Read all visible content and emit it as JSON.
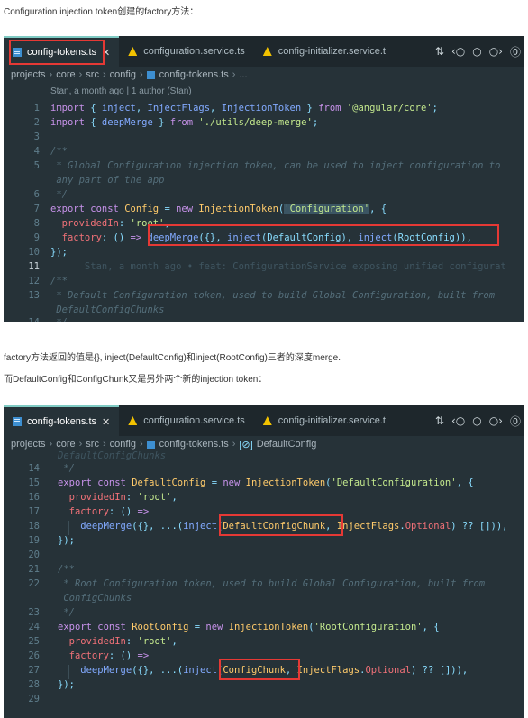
{
  "intro_text": "Configuration injection token创建的factory方法：",
  "middle_text_1": "factory方法返回的值是{}, inject(DefaultConfig)和inject(RootConfig)三者的深度merge.",
  "middle_text_2": "而DefaultConfig和ConfigChunk又是另外两个新的injection token：",
  "screen1": {
    "tabs": [
      {
        "label": "config-tokens.ts",
        "close": "✕"
      },
      {
        "label": "configuration.service.ts"
      },
      {
        "label": "config-initializer.service.t"
      }
    ],
    "actions": [
      "⇅",
      "‹○",
      "○",
      "○›",
      "⓪"
    ],
    "breadcrumb": [
      "projects",
      "core",
      "src",
      "config",
      "config-tokens.ts",
      "..."
    ],
    "blame_header": "Stan, a month ago | 1 author (Stan)",
    "lines": [
      "1",
      "2",
      "3",
      "4",
      "5",
      "",
      "6",
      "7",
      "8",
      "9",
      "10",
      "11",
      "12",
      "13",
      "",
      "14"
    ],
    "code": {
      "l1_a": "import",
      "l1_b": " { ",
      "l1_c": "inject",
      "l1_d": ", ",
      "l1_e": "InjectFlags",
      "l1_f": ", ",
      "l1_g": "InjectionToken",
      "l1_h": " } ",
      "l1_i": "from",
      "l1_j": " '@angular/core'",
      "l1_k": ";",
      "l2_a": "import",
      "l2_b": " { ",
      "l2_c": "deepMerge",
      "l2_d": " } ",
      "l2_e": "from",
      "l2_f": " './utils/deep-merge'",
      "l2_g": ";",
      "l4": "/**",
      "l5a": " * Global Configuration injection token, can be used to inject configuration to",
      "l5b": " any part of the app",
      "l6": " */",
      "l7_a": "export",
      "l7_b": " const ",
      "l7_c": "Config",
      "l7_d": " = ",
      "l7_e": "new ",
      "l7_f": "InjectionToken",
      "l7_g": "(",
      "l7_h": "'Configuration'",
      "l7_i": ", {",
      "l8_a": "  providedIn",
      "l8_b": ": ",
      "l8_c": "'root'",
      "l8_d": ",",
      "l9_a": "  factory",
      "l9_b": ": () ",
      "l9_c": "=>",
      "l9_d": " deepMerge",
      "l9_e": "({}, ",
      "l9_f": "inject",
      "l9_g": "(DefaultConfig), ",
      "l9_h": "inject",
      "l9_i": "(RootConfig)),",
      "l10": "});",
      "l11_blame": "      Stan, a month ago • feat: ConfigurationService exposing unified configurat",
      "l12": "/**",
      "l13a": " * Default Configuration token, used to build Global Configuration, built from",
      "l13b": " DefaultConfigChunks",
      "l14": " */"
    }
  },
  "screen2": {
    "tabs": [
      {
        "label": "config-tokens.ts",
        "close": "✕"
      },
      {
        "label": "configuration.service.ts"
      },
      {
        "label": "config-initializer.service.t"
      }
    ],
    "actions": [
      "⇅",
      "‹○",
      "○",
      "○›",
      "⓪"
    ],
    "breadcrumb": [
      "projects",
      "core",
      "src",
      "config",
      "config-tokens.ts",
      "DefaultConfig"
    ],
    "ghost_line": "DefaultConfigChunks",
    "lines": [
      "14",
      "15",
      "16",
      "17",
      "18",
      "19",
      "20",
      "21",
      "22",
      "",
      "23",
      "24",
      "25",
      "26",
      "27",
      "28",
      "29"
    ],
    "code": {
      "l14": " */",
      "l15_a": "export",
      "l15_b": " const ",
      "l15_c": "DefaultConfig",
      "l15_d": " = ",
      "l15_e": "new ",
      "l15_f": "InjectionToken",
      "l15_g": "(",
      "l15_h": "'DefaultConfiguration'",
      "l15_i": ", {",
      "l16_a": "  providedIn",
      "l16_b": ": ",
      "l16_c": "'root'",
      "l16_d": ",",
      "l17_a": "  factory",
      "l17_b": ": () ",
      "l17_c": "=>",
      "l18_a": "    deepMerge",
      "l18_b": "({}, ...(",
      "l18_c": "inject",
      "l18_d": "(",
      "l18_e": "DefaultConfigChunk",
      "l18_f": ", ",
      "l18_g": "InjectFlags",
      "l18_h": ".",
      "l18_i": "Optional",
      "l18_j": ") ?? [])),",
      "l19": "});",
      "l21": "/**",
      "l22a": " * Root Configuration token, used to build Global Configuration, built from",
      "l22b": " ConfigChunks",
      "l23": " */",
      "l24_a": "export",
      "l24_b": " const ",
      "l24_c": "RootConfig",
      "l24_d": " = ",
      "l24_e": "new ",
      "l24_f": "InjectionToken",
      "l24_g": "(",
      "l24_h": "'RootConfiguration'",
      "l24_i": ", {",
      "l25_a": "  providedIn",
      "l25_b": ": ",
      "l25_c": "'root'",
      "l25_d": ",",
      "l26_a": "  factory",
      "l26_b": ": () ",
      "l26_c": "=>",
      "l27_a": "    deepMerge",
      "l27_b": "({}, ...(",
      "l27_c": "inject",
      "l27_d": "(",
      "l27_e": "ConfigChunk",
      "l27_f": ", ",
      "l27_g": "InjectFlags",
      "l27_h": ".",
      "l27_i": "Optional",
      "l27_j": ") ?? [])),",
      "l28": "});"
    }
  },
  "colors": {
    "editor_bg": "#263238",
    "highlight_box": "#e53935",
    "keyword": "#c792ea",
    "string": "#c3e88d",
    "function": "#82aaff",
    "class": "#ffcb6b",
    "comment": "#546e7a"
  },
  "icons": [
    "typescript-file-icon",
    "angular-icon",
    "close-icon",
    "compare-icon",
    "go-back-icon",
    "go-forward-icon",
    "more-icon"
  ]
}
